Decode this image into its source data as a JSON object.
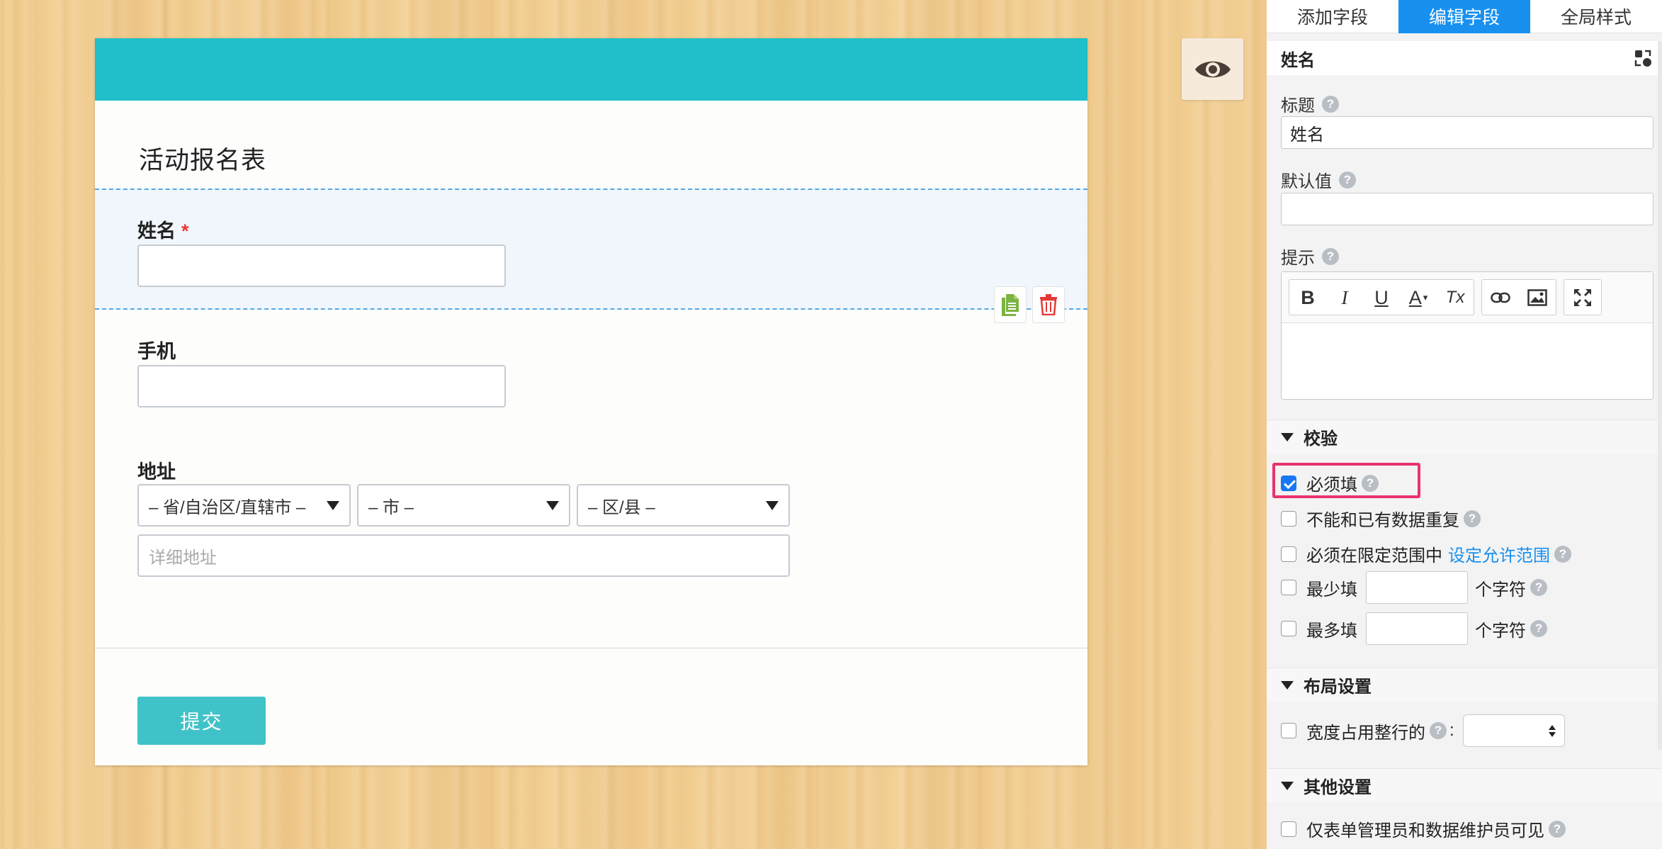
{
  "form": {
    "title": "活动报名表",
    "fields": {
      "name": {
        "label": "姓名",
        "required_mark": "*"
      },
      "phone": {
        "label": "手机"
      },
      "address": {
        "label": "地址",
        "province": "– 省/自治区/直辖市 –",
        "city": "– 市 –",
        "district": "– 区/县 –",
        "detail_placeholder": "详细地址"
      }
    },
    "submit_label": "提交",
    "header_color": "#20bfca",
    "selected_field_bg": "#f0f6fc"
  },
  "field_actions": {
    "copy_icon": "copy-document-icon",
    "delete_icon": "trash-icon"
  },
  "preview": {
    "icon": "eye-icon"
  },
  "panel": {
    "tabs": [
      {
        "label": "添加字段",
        "active": false
      },
      {
        "label": "编辑字段",
        "active": true
      },
      {
        "label": "全局样式",
        "active": false
      }
    ],
    "field_name": "姓名",
    "props": {
      "title_label": "标题",
      "title_value": "姓名",
      "default_label": "默认值",
      "default_value": "",
      "hint_label": "提示"
    },
    "editor_tools": [
      "B",
      "I",
      "U",
      "A",
      "Tx",
      "link",
      "image",
      "fullscreen"
    ],
    "validation": {
      "heading": "校验",
      "required": {
        "label": "必须填",
        "checked": true
      },
      "no_duplicate": {
        "label": "不能和已有数据重复",
        "checked": false
      },
      "in_range": {
        "label": "必须在限定范围中",
        "link": "设定允许范围",
        "checked": false
      },
      "min_len": {
        "label": "最少填",
        "unit": "个字符",
        "checked": false
      },
      "max_len": {
        "label": "最多填",
        "unit": "个字符",
        "checked": false
      }
    },
    "layout": {
      "heading": "布局设置",
      "full_width": {
        "label": "宽度占用整行的",
        "suffix": ":",
        "checked": false
      }
    },
    "other": {
      "heading": "其他设置",
      "admin_only": {
        "label": "仅表单管理员和数据维护员可见",
        "checked": false
      }
    },
    "accent_color": "#1890f0",
    "highlight_color": "#e8336d"
  }
}
